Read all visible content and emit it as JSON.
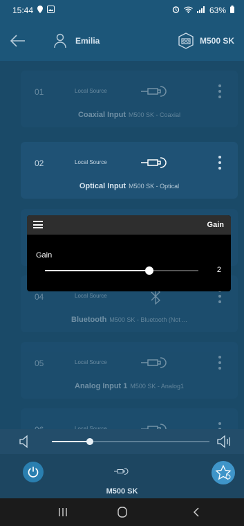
{
  "status": {
    "time": "15:44",
    "battery": "63%"
  },
  "header": {
    "user_name": "Emilia",
    "device_name": "M500 SK"
  },
  "sources": [
    {
      "number": "01",
      "type": "Local Source",
      "title": "Coaxial Input",
      "subtitle": "M500 SK - Coaxial",
      "icon": "coax-plug-icon"
    },
    {
      "number": "02",
      "type": "Local Source",
      "title": "Optical Input",
      "subtitle": "M500 SK - Optical",
      "icon": "optical-plug-icon"
    },
    {
      "number": "04",
      "type": "Local Source",
      "title": "Bluetooth",
      "subtitle": "M500 SK - Bluetooth (Not ...",
      "icon": "bluetooth-icon"
    },
    {
      "number": "05",
      "type": "Local Source",
      "title": "Analog Input 1",
      "subtitle": "M500 SK - Analog1",
      "icon": "analog-plug-icon"
    },
    {
      "number": "06",
      "type": "Local Source",
      "title": "",
      "subtitle": "",
      "icon": "analog-plug-icon"
    }
  ],
  "gain_dialog": {
    "title": "Gain",
    "label": "Gain",
    "value": "2",
    "slider_fraction": 0.68
  },
  "volume": {
    "fraction": 0.24
  },
  "player": {
    "device_name": "M500 SK"
  },
  "colors": {
    "accent": "#3f95c9",
    "background": "#1a4a68",
    "card": "#1f5275"
  }
}
